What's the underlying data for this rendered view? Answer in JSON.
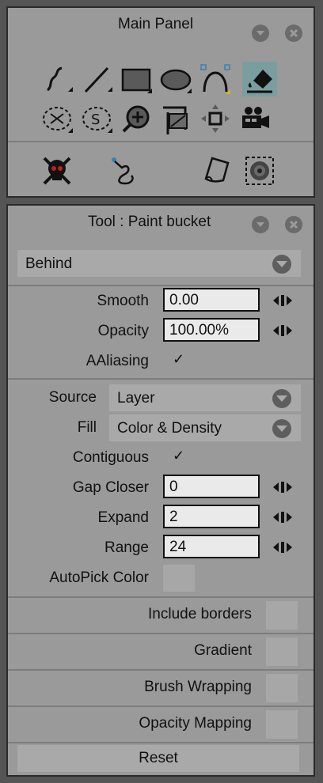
{
  "main_panel": {
    "title": "Main Panel",
    "tools_row1": [
      {
        "icon": "freehand-icon"
      },
      {
        "icon": "line-icon"
      },
      {
        "icon": "rectangle-icon"
      },
      {
        "icon": "ellipse-icon"
      },
      {
        "icon": "bezier-curve-icon",
        "selected": false
      },
      {
        "icon": "paint-bucket-icon",
        "selected": true
      }
    ],
    "tools_row2": [
      {
        "icon": "cutter-icon"
      },
      {
        "icon": "smart-select-icon"
      },
      {
        "icon": "zoom-icon"
      },
      {
        "icon": "crop-icon"
      },
      {
        "icon": "move-icon"
      },
      {
        "icon": "camera-icon"
      }
    ],
    "tools_row3": [
      {
        "icon": "skull-eraser-icon"
      },
      {
        "icon": "rig-pen-icon"
      },
      {
        "icon": "paper-icon"
      },
      {
        "icon": "texture-icon"
      }
    ]
  },
  "tool_panel": {
    "title": "Tool : Paint bucket",
    "mode": "Behind",
    "smooth_label": "Smooth",
    "smooth_value": "0.00",
    "opacity_label": "Opacity",
    "opacity_value": "100.00%",
    "aaliasing_label": "AAliasing",
    "aaliasing_checked": true,
    "source_label": "Source",
    "source_value": "Layer",
    "fill_label": "Fill",
    "fill_value": "Color & Density",
    "contiguous_label": "Contiguous",
    "contiguous_checked": true,
    "gap_closer_label": "Gap Closer",
    "gap_closer_value": "0",
    "expand_label": "Expand",
    "expand_value": "2",
    "range_label": "Range",
    "range_value": "24",
    "autopick_label": "AutoPick Color",
    "include_borders_label": "Include borders",
    "gradient_label": "Gradient",
    "brush_wrapping_label": "Brush Wrapping",
    "opacity_mapping_label": "Opacity Mapping",
    "reset_label": "Reset",
    "check_glyph": "✓"
  },
  "colors": {
    "panel": "#9a9a9a",
    "selected": "#7a9ea0",
    "field": "#eaeaea",
    "background": "#555555"
  }
}
